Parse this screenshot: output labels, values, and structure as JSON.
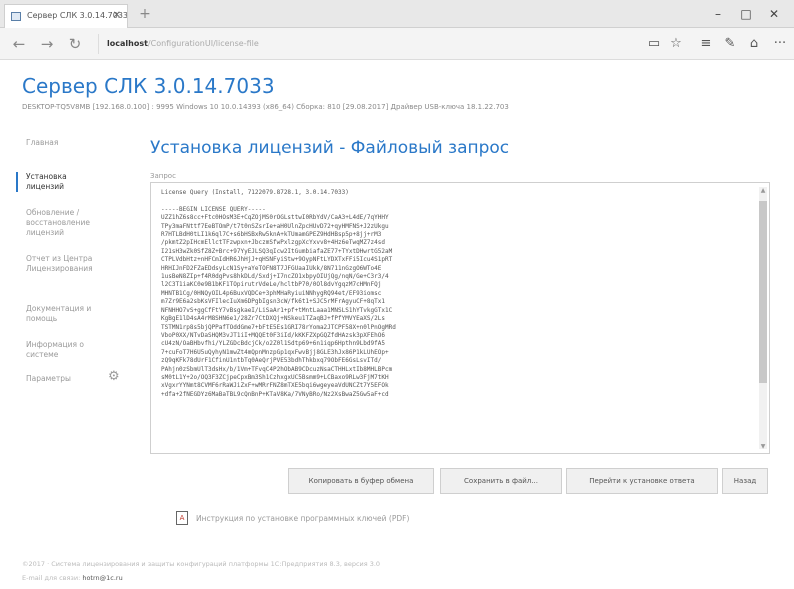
{
  "browser": {
    "tab_title": "Сервер СЛК 3.0.14.7033",
    "tab_close": "✕",
    "new_tab": "+",
    "win_minimize": "–",
    "win_maximize": "□",
    "win_close": "✕",
    "back": "←",
    "forward": "→",
    "refresh": "↻",
    "address_host": "localhost",
    "address_path": "/ConfigurationUI/license-file",
    "icons": {
      "reading": "▭",
      "favorite": "☆",
      "hub": "≡",
      "notes": "✎",
      "share": "⌂",
      "more": "···"
    }
  },
  "header": {
    "title": "Сервер СЛК 3.0.14.7033",
    "subtitle": "DESKTOP-TQ5V8MB [192.168.0.100] : 9995    Windows 10 10.0.14393 (x86_64)    Сборка: 810 [29.08.2017]    Драйвер USB-ключа 18.1.22.703"
  },
  "sidebar": {
    "items": [
      {
        "label": "Главная"
      },
      {
        "label": "Установка\nлицензий",
        "active": true
      },
      {
        "label": "Обновление /\nвосстановление\nлицензий"
      },
      {
        "label": "Отчет из Центра\nЛицензирования"
      },
      {
        "label": "Документация и\nпомощь"
      },
      {
        "label": "Информация о\nсистеме"
      },
      {
        "label": "Параметры"
      }
    ],
    "gear_icon": "⚙"
  },
  "main": {
    "title": "Установка лицензий - Файловый запрос",
    "field_label": "Запрос",
    "request_text": "License Query (Install, 7122079.8728.1, 3.0.14.7033)\n\n-----BEGIN LICENSE QUERY-----\nUZZ1hZ6s8cc+Ftc0HOsM3E+CqZOjMS0rOGLsttwI0RbYdV/CaA3+L4dE/7qYHHY\nTPy3maFNttf7EeBTOmP/t7t0nSZsrIe+aH0UlnZpcHUvD72+qyHMFNS+J2zUkgu\nR7HTLBdH0tLI1k6ql7C+s6bHSBxRw5knA+kTUmamGPEZ9HdHBsp5p+8jj+rM3\n/pkmtZ2pIHcmEllctTFzwpxn+JbczmSfwPxlzgpXcYxvv8+4Hz6eTwqMZ7z4sd\nI21sH3wZk0SfZ8Z+Brc+97YyEJLSQ3qIcw2ItGumbiafaZE77+TYxtDHwrtG52aM\nCTPLVdbHtz+nHFCmIdHR6JhHjJ+qHSNFyiStw+9OypNFtLYDXTxFFi5Icu4S1pRT\nHRHIJnFD2FZaEDdsyLcN1Sy+aYeTOFN8T7JFGUaaIUkk/8N711nGzgO6WTo4E\n1usBeN8ZIp+f4R0dgPvs8hkDLd/Sxdj+I7ncZO1xbpyOIUjQg/nqN/Ge+C3r3/4\nl2C3T1iaKC0e9B1bKF1TOpirutrVdeLe/hcltbP70/0Ol8dvYgqzM7cHMnFQj\nMHNTB1Cg/0HNQyOIL4p6BuxVQDCe+3phMHaRyiuiNNhygRQ94et/EF93iomsc\nm7Zr9E6a2sbKsVFIlecIuXm6DPgbIgsn3cW/fk6t1+SJC5rMFrAgyuCF+8qTx1\nNFNHHO7vS+ggCfFtY7vBsgkaeI/LiSaAr1+pf+tMntLaaa1MNSLS1hYTvkgGTx1C\nKgBgE1lD4sA4rM8SHN6e1/28Zr7CtDXQj+NSkeu1TZaqBJ+fPfYMVYEaXS/2Ls\nTSTMN1rp8s5bjQPPafTOddGme7+bFtE5Es1GRI78rYoma2JTCPF58X+n0lPnOgMRd\nVboP0XX/NTvDaSHQM3vJT1iI+MQQEt0F3iId/kKKFZXpGQZfdHAzsk3pXFEhO6\ncU4zN/OaBHbvfhi/YLZGDcBdcjCk/o2Z0l1Sdtp69+6n1iqp6Hpthn9Lbd9fA5\n7+cuFoT7H6U5uQyhyN1mwZt4mQpnMnzpGp1qxFwvBjj8GLE3hJx86P1kLUhEOp+\nzQ9qKFk78dUrF1CfinU1ntbTq0AeQrjPVE53bdhThkbxq79ObFE6GsLsvITd/\nPAhjn0zSbmUlT3dsHx/b/1Vm+TFvqC4P2hObAB9CDcuzNsaCTHHLxtIb8MHLBPcm\nsM0tL1Y+2o/OQ3F3ZCjpeCpxBm3Sh1CzhxgxUC5Bsmm9+LCBaxo9RLw3FjM7tKH\nxVgxrYYNmt8CVMF6rRaWJiZxF+wMRrFNZ8mTXE5bqi6wgeyeaVdUNCZt7Y5EFOk\n+dfa+2fNEGDYz6MaBaTBL9cQnBnP+KTaV8Ka/7VNyBRo/Nz2XsBwaZ5Gw5aF+cd"
  },
  "buttons": {
    "copy": "Копировать в буфер обмена",
    "save": "Сохранить в файл...",
    "go_install": "Перейти к установке ответа",
    "back": "Назад"
  },
  "instruction": {
    "link": "Инструкция по установке программных ключей (PDF)",
    "pdf_icon": "A"
  },
  "footer": {
    "line1": "©2017 · Система лицензирования и защиты конфигураций платформы 1С:Предприятия 8.3, версия 3.0",
    "line2_prefix": "E-mail для связи: ",
    "line2_email": "hotrn@1c.ru"
  }
}
